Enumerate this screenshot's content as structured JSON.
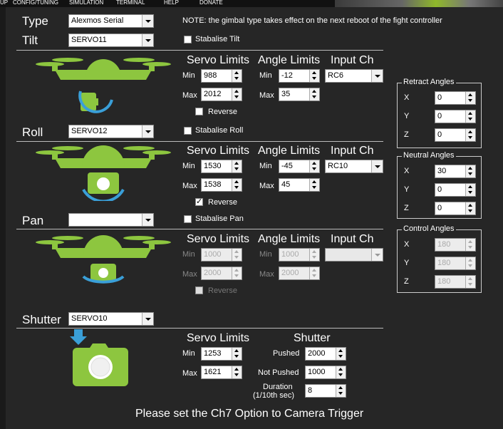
{
  "menu": {
    "items": [
      "UP",
      "CONFIG/TUNING",
      "SIMULATION",
      "TERMINAL",
      "HELP",
      "DONATE"
    ]
  },
  "type": {
    "label": "Type",
    "value": "Alexmos Serial",
    "note": "NOTE: the gimbal type takes effect on the next reboot of the fight controller"
  },
  "column_headers": {
    "servo_limits": "Servo Limits",
    "angle_limits": "Angle Limits",
    "input_ch": "Input Ch",
    "min": "Min",
    "max": "Max",
    "reverse": "Reverse"
  },
  "tilt": {
    "label": "Tilt",
    "output": "SERVO11",
    "stabilise": "Stabalise Tilt",
    "stabilise_checked": false,
    "servo_min": "988",
    "servo_max": "2012",
    "angle_min": "-12",
    "angle_max": "35",
    "input": "RC6",
    "reverse_checked": false
  },
  "roll": {
    "label": "Roll",
    "output": "SERVO12",
    "stabilise": "Stabalise Roll",
    "stabilise_checked": false,
    "servo_min": "1530",
    "servo_max": "1538",
    "angle_min": "-45",
    "angle_max": "45",
    "input": "RC10",
    "reverse_checked": true
  },
  "pan": {
    "label": "Pan",
    "output": "",
    "stabilise": "Stabalise Pan",
    "stabilise_checked": false,
    "servo_min": "1000",
    "servo_max": "2000",
    "angle_min": "1000",
    "angle_max": "2000",
    "input": "",
    "reverse_checked": false,
    "enabled": false
  },
  "retract": {
    "title": "Retract Angles",
    "x": "0",
    "y": "0",
    "z": "0"
  },
  "neutral": {
    "title": "Neutral Angles",
    "x": "30",
    "y": "0",
    "z": "0"
  },
  "control": {
    "title": "Control Angles",
    "x": "180",
    "y": "180",
    "z": "180"
  },
  "axis_labels": {
    "x": "X",
    "y": "Y",
    "z": "Z"
  },
  "shutter": {
    "label": "Shutter",
    "output": "SERVO10",
    "servo_header": "Servo Limits",
    "shutter_header": "Shutter",
    "servo_min": "1253",
    "servo_max": "1621",
    "pushed_label": "Pushed",
    "pushed": "2000",
    "not_pushed_label": "Not Pushed",
    "not_pushed": "1000",
    "duration_label": "Duration",
    "duration_unit": "(1/10th sec)",
    "duration": "8"
  },
  "footer": "Please set the Ch7 Option to Camera Trigger",
  "colors": {
    "accent": "#8dc63f",
    "arrow": "#3a9fd8",
    "background": "#262626"
  }
}
